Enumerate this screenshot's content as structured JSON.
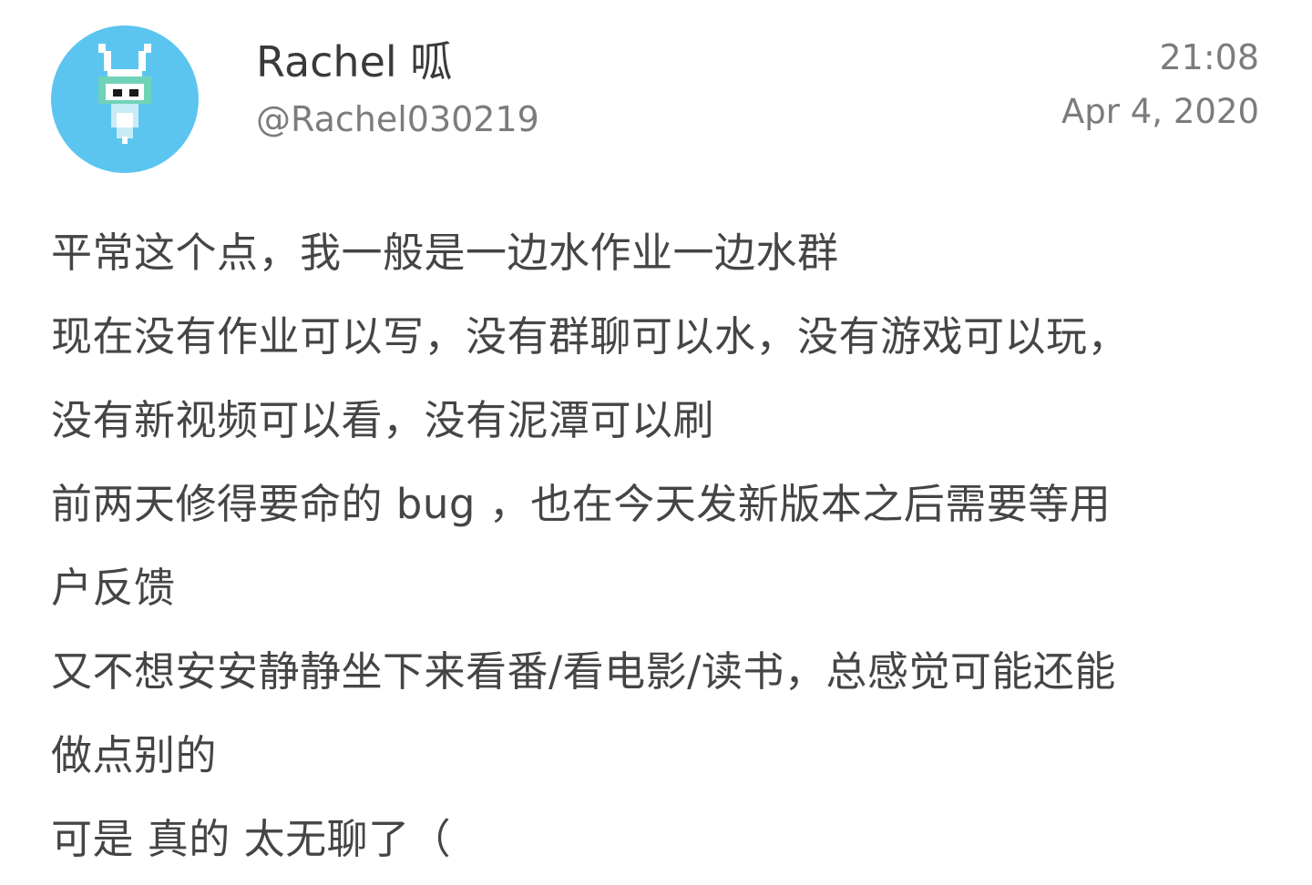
{
  "author": {
    "display_name": "Rachel 呱",
    "handle": "@Rachel030219",
    "avatar_icon": "pixel-bunny-avatar",
    "avatar_bg": "#5bc5ef"
  },
  "meta": {
    "time": "21:08",
    "date": "Apr 4, 2020"
  },
  "post": {
    "lines": [
      "平常这个点，我一般是一边水作业一边水群",
      "现在没有作业可以写，没有群聊可以水，没有游戏可以玩，",
      "没有新视频可以看，没有泥潭可以刷",
      "前两天修得要命的 bug ，也在今天发新版本之后需要等用",
      "户反馈",
      "又不想安安静静坐下来看番/看电影/读书，总感觉可能还能",
      "做点别的",
      "可是 真的 太无聊了（"
    ]
  }
}
